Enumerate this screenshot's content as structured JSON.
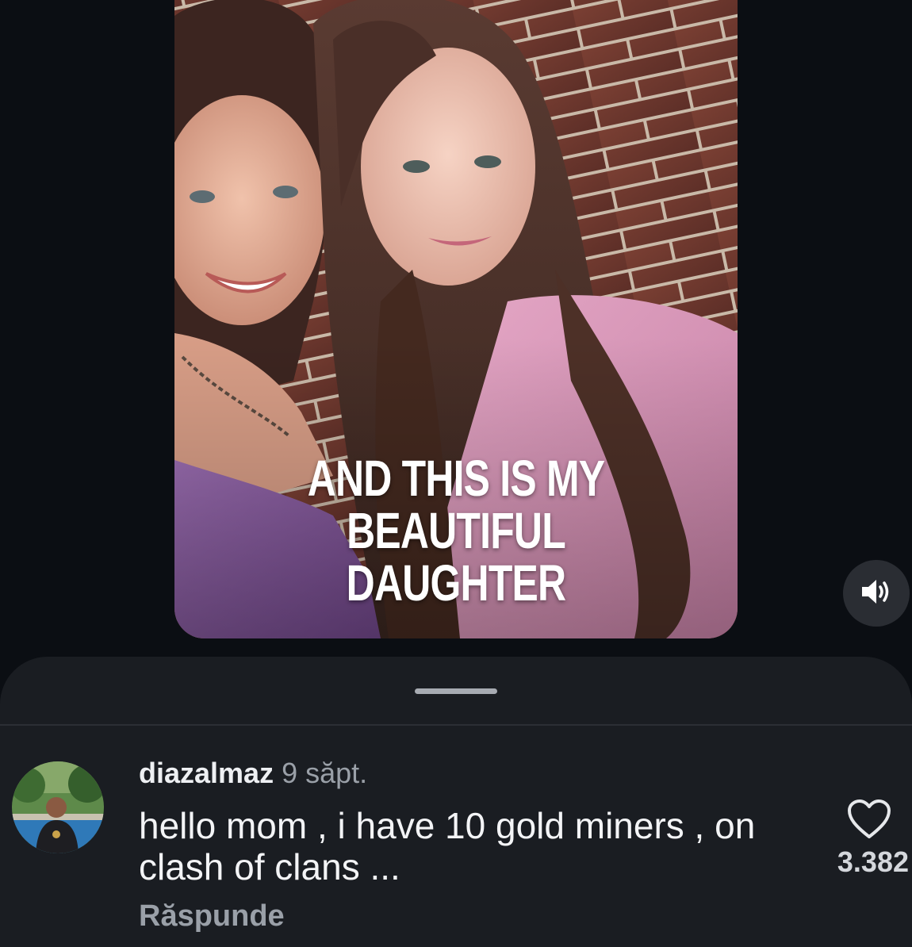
{
  "video": {
    "caption_line1": "AND THIS IS MY",
    "caption_line2": "BEAUTIFUL DAUGHTER",
    "volume_icon": "volume-on-icon"
  },
  "comments": [
    {
      "username": "diazalmaz",
      "timestamp": "9 săpt.",
      "text": "hello mom , i have 10 gold miners , on clash of clans ...",
      "reply_label": "Răspunde",
      "like_count": "3.382",
      "like_icon": "heart-outline-icon"
    }
  ],
  "colors": {
    "background": "#0b0e13",
    "sheet": "#1a1d22",
    "secondary_text": "#9aa0a8",
    "primary_text": "#eef0f3"
  }
}
